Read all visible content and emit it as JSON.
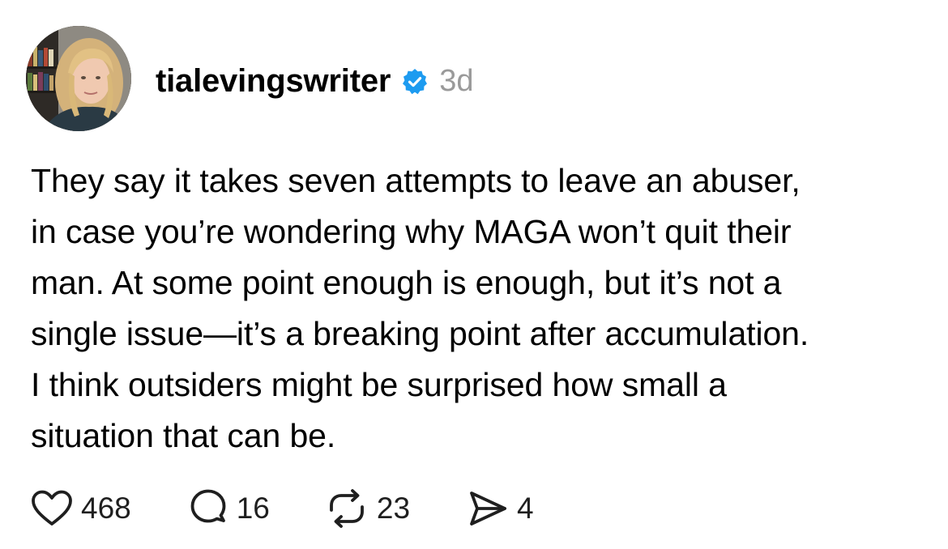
{
  "post": {
    "username": "tialevingswriter",
    "verified": true,
    "verified_icon": "verified-badge-icon",
    "verified_color": "#1d9bf0",
    "time_ago": "3d",
    "body_lines": [
      "They say it takes seven attempts to leave an abuser,",
      "in case you’re wondering why MAGA won’t quit their",
      "man. At some point enough is enough, but it’s not a",
      "single issue—it’s a breaking point after accumulation.",
      "I think outsiders might be surprised how small a",
      "situation that can be."
    ],
    "actions": {
      "like": {
        "icon": "heart-icon",
        "count": "468"
      },
      "reply": {
        "icon": "comment-icon",
        "count": "16"
      },
      "repost": {
        "icon": "repost-icon",
        "count": "23"
      },
      "share": {
        "icon": "send-icon",
        "count": "4"
      }
    }
  }
}
